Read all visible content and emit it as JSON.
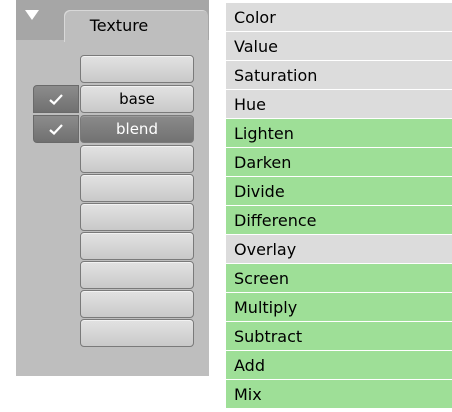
{
  "texture_panel": {
    "tab_label": "Texture",
    "slots": [
      {
        "label": "",
        "checked": false,
        "selected": false
      },
      {
        "label": "base",
        "checked": true,
        "selected": false
      },
      {
        "label": "blend",
        "checked": true,
        "selected": true
      },
      {
        "label": "",
        "checked": false,
        "selected": false
      },
      {
        "label": "",
        "checked": false,
        "selected": false
      },
      {
        "label": "",
        "checked": false,
        "selected": false
      },
      {
        "label": "",
        "checked": false,
        "selected": false
      },
      {
        "label": "",
        "checked": false,
        "selected": false
      },
      {
        "label": "",
        "checked": false,
        "selected": false
      },
      {
        "label": "",
        "checked": false,
        "selected": false
      }
    ]
  },
  "blend_modes": {
    "items": [
      {
        "label": "Color",
        "group": "gray"
      },
      {
        "label": "Value",
        "group": "gray"
      },
      {
        "label": "Saturation",
        "group": "gray"
      },
      {
        "label": "Hue",
        "group": "gray"
      },
      {
        "label": "Lighten",
        "group": "green"
      },
      {
        "label": "Darken",
        "group": "green"
      },
      {
        "label": "Divide",
        "group": "green"
      },
      {
        "label": "Difference",
        "group": "green"
      },
      {
        "label": "Overlay",
        "group": "gray"
      },
      {
        "label": "Screen",
        "group": "green"
      },
      {
        "label": "Multiply",
        "group": "green"
      },
      {
        "label": "Subtract",
        "group": "green"
      },
      {
        "label": "Add",
        "group": "green"
      },
      {
        "label": "Mix",
        "group": "green"
      }
    ]
  },
  "colors": {
    "panel_bg": "#bebebe",
    "selected_slot": "#7e7e7e",
    "list_gray": "#dcdcdc",
    "list_green": "#9edf97"
  },
  "icons": {
    "collapse": "triangle-down-icon",
    "check": "checkmark-icon"
  }
}
